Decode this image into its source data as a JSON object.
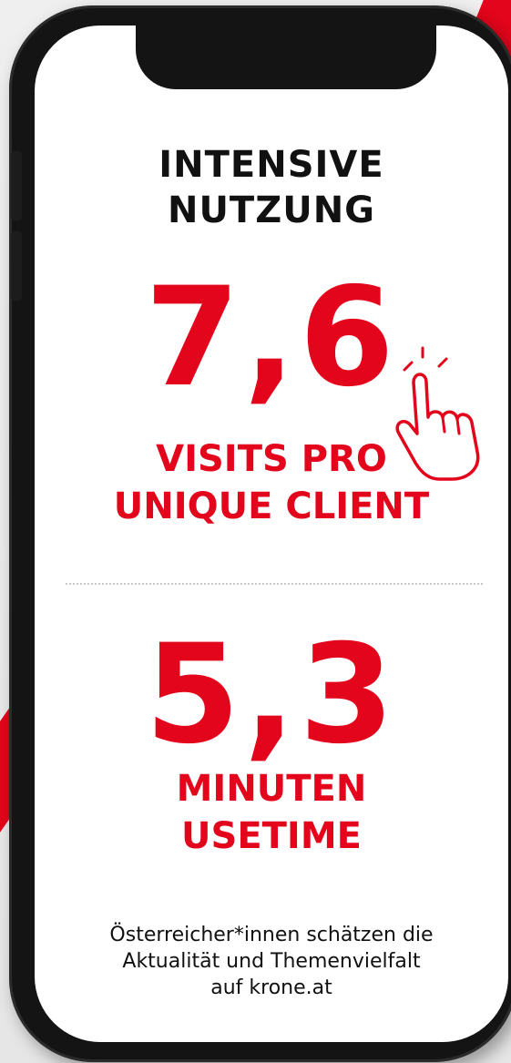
{
  "headline": {
    "line1": "INTENSIVE",
    "line2": "NUTZUNG"
  },
  "stat1": {
    "value": "7,6",
    "label_line1": "VISITS PRO",
    "label_line2": "UNIQUE CLIENT"
  },
  "stat2": {
    "value": "5,3",
    "label_line1": "MINUTEN",
    "label_line2": "USETIME"
  },
  "footnote": {
    "line1": "Österreicher*innen schätzen die",
    "line2": "Aktualität und Themenvielfalt",
    "line3": "auf krone.at"
  },
  "colors": {
    "accent": "#e3051b",
    "text": "#111111",
    "phone": "#141414",
    "screen": "#ffffff"
  },
  "icons": {
    "pointer": "hand-pointer-icon"
  }
}
